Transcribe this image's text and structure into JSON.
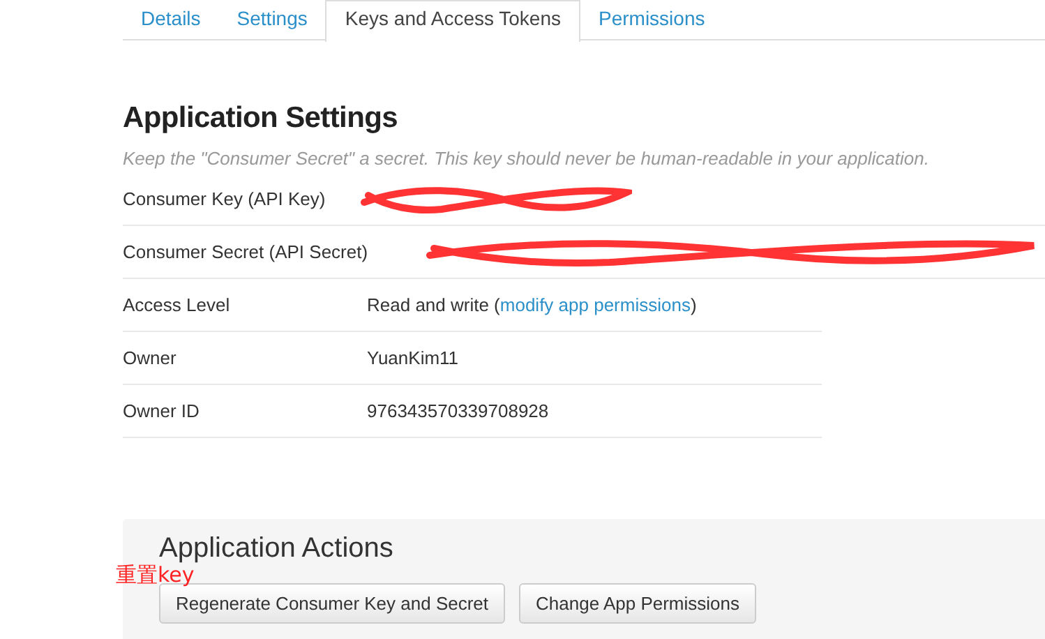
{
  "tabs": [
    {
      "label": "Details",
      "selected": false
    },
    {
      "label": "Settings",
      "selected": false
    },
    {
      "label": "Keys and Access Tokens",
      "selected": true
    },
    {
      "label": "Permissions",
      "selected": false
    }
  ],
  "settings": {
    "title": "Application Settings",
    "note": "Keep the \"Consumer Secret\" a secret. This key should never be human-readable in your application.",
    "rows": [
      {
        "kind": "redacted",
        "label": "Consumer Key (API Key)"
      },
      {
        "kind": "redacted",
        "label": "Consumer Secret (API Secret)"
      },
      {
        "kind": "link",
        "label": "Access Level",
        "before": "Read and write (",
        "link": "modify app permissions",
        "after": ")"
      },
      {
        "kind": "text",
        "label": "Owner",
        "value": "YuanKim11"
      },
      {
        "kind": "text",
        "label": "Owner ID",
        "value": "976343570339708928"
      }
    ]
  },
  "actions": {
    "title": "Application Actions",
    "annotation": "重置key",
    "buttons": [
      "Regenerate Consumer Key and Secret",
      "Change App Permissions"
    ]
  }
}
